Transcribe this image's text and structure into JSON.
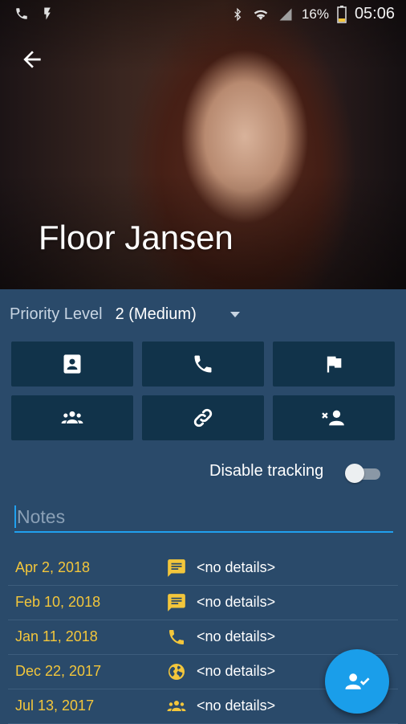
{
  "status_bar": {
    "battery": "16%",
    "time": "05:06"
  },
  "contact": {
    "name": "Floor Jansen"
  },
  "priority": {
    "label": "Priority Level",
    "value": "2 (Medium)"
  },
  "action_buttons": [
    {
      "icon": "contact-card-icon"
    },
    {
      "icon": "phone-icon"
    },
    {
      "icon": "flag-icon"
    },
    {
      "icon": "group-icon"
    },
    {
      "icon": "link-icon"
    },
    {
      "icon": "remove-person-icon"
    }
  ],
  "tracking": {
    "label": "Disable tracking",
    "enabled": false
  },
  "notes": {
    "placeholder": "Notes"
  },
  "history": [
    {
      "date": "Apr 2, 2018",
      "icon": "message-icon",
      "details": "<no details>"
    },
    {
      "date": "Feb 10, 2018",
      "icon": "message-icon",
      "details": "<no details>"
    },
    {
      "date": "Jan 11, 2018",
      "icon": "phone-icon",
      "details": "<no details>"
    },
    {
      "date": "Dec 22, 2017",
      "icon": "globe-icon",
      "details": "<no details>"
    },
    {
      "date": "Jul 13, 2017",
      "icon": "group-icon",
      "details": "<no details>"
    }
  ],
  "colors": {
    "accent": "#1a9eea",
    "date": "#f3c63b",
    "button": "#11334a",
    "background": "#2a4a6a"
  }
}
